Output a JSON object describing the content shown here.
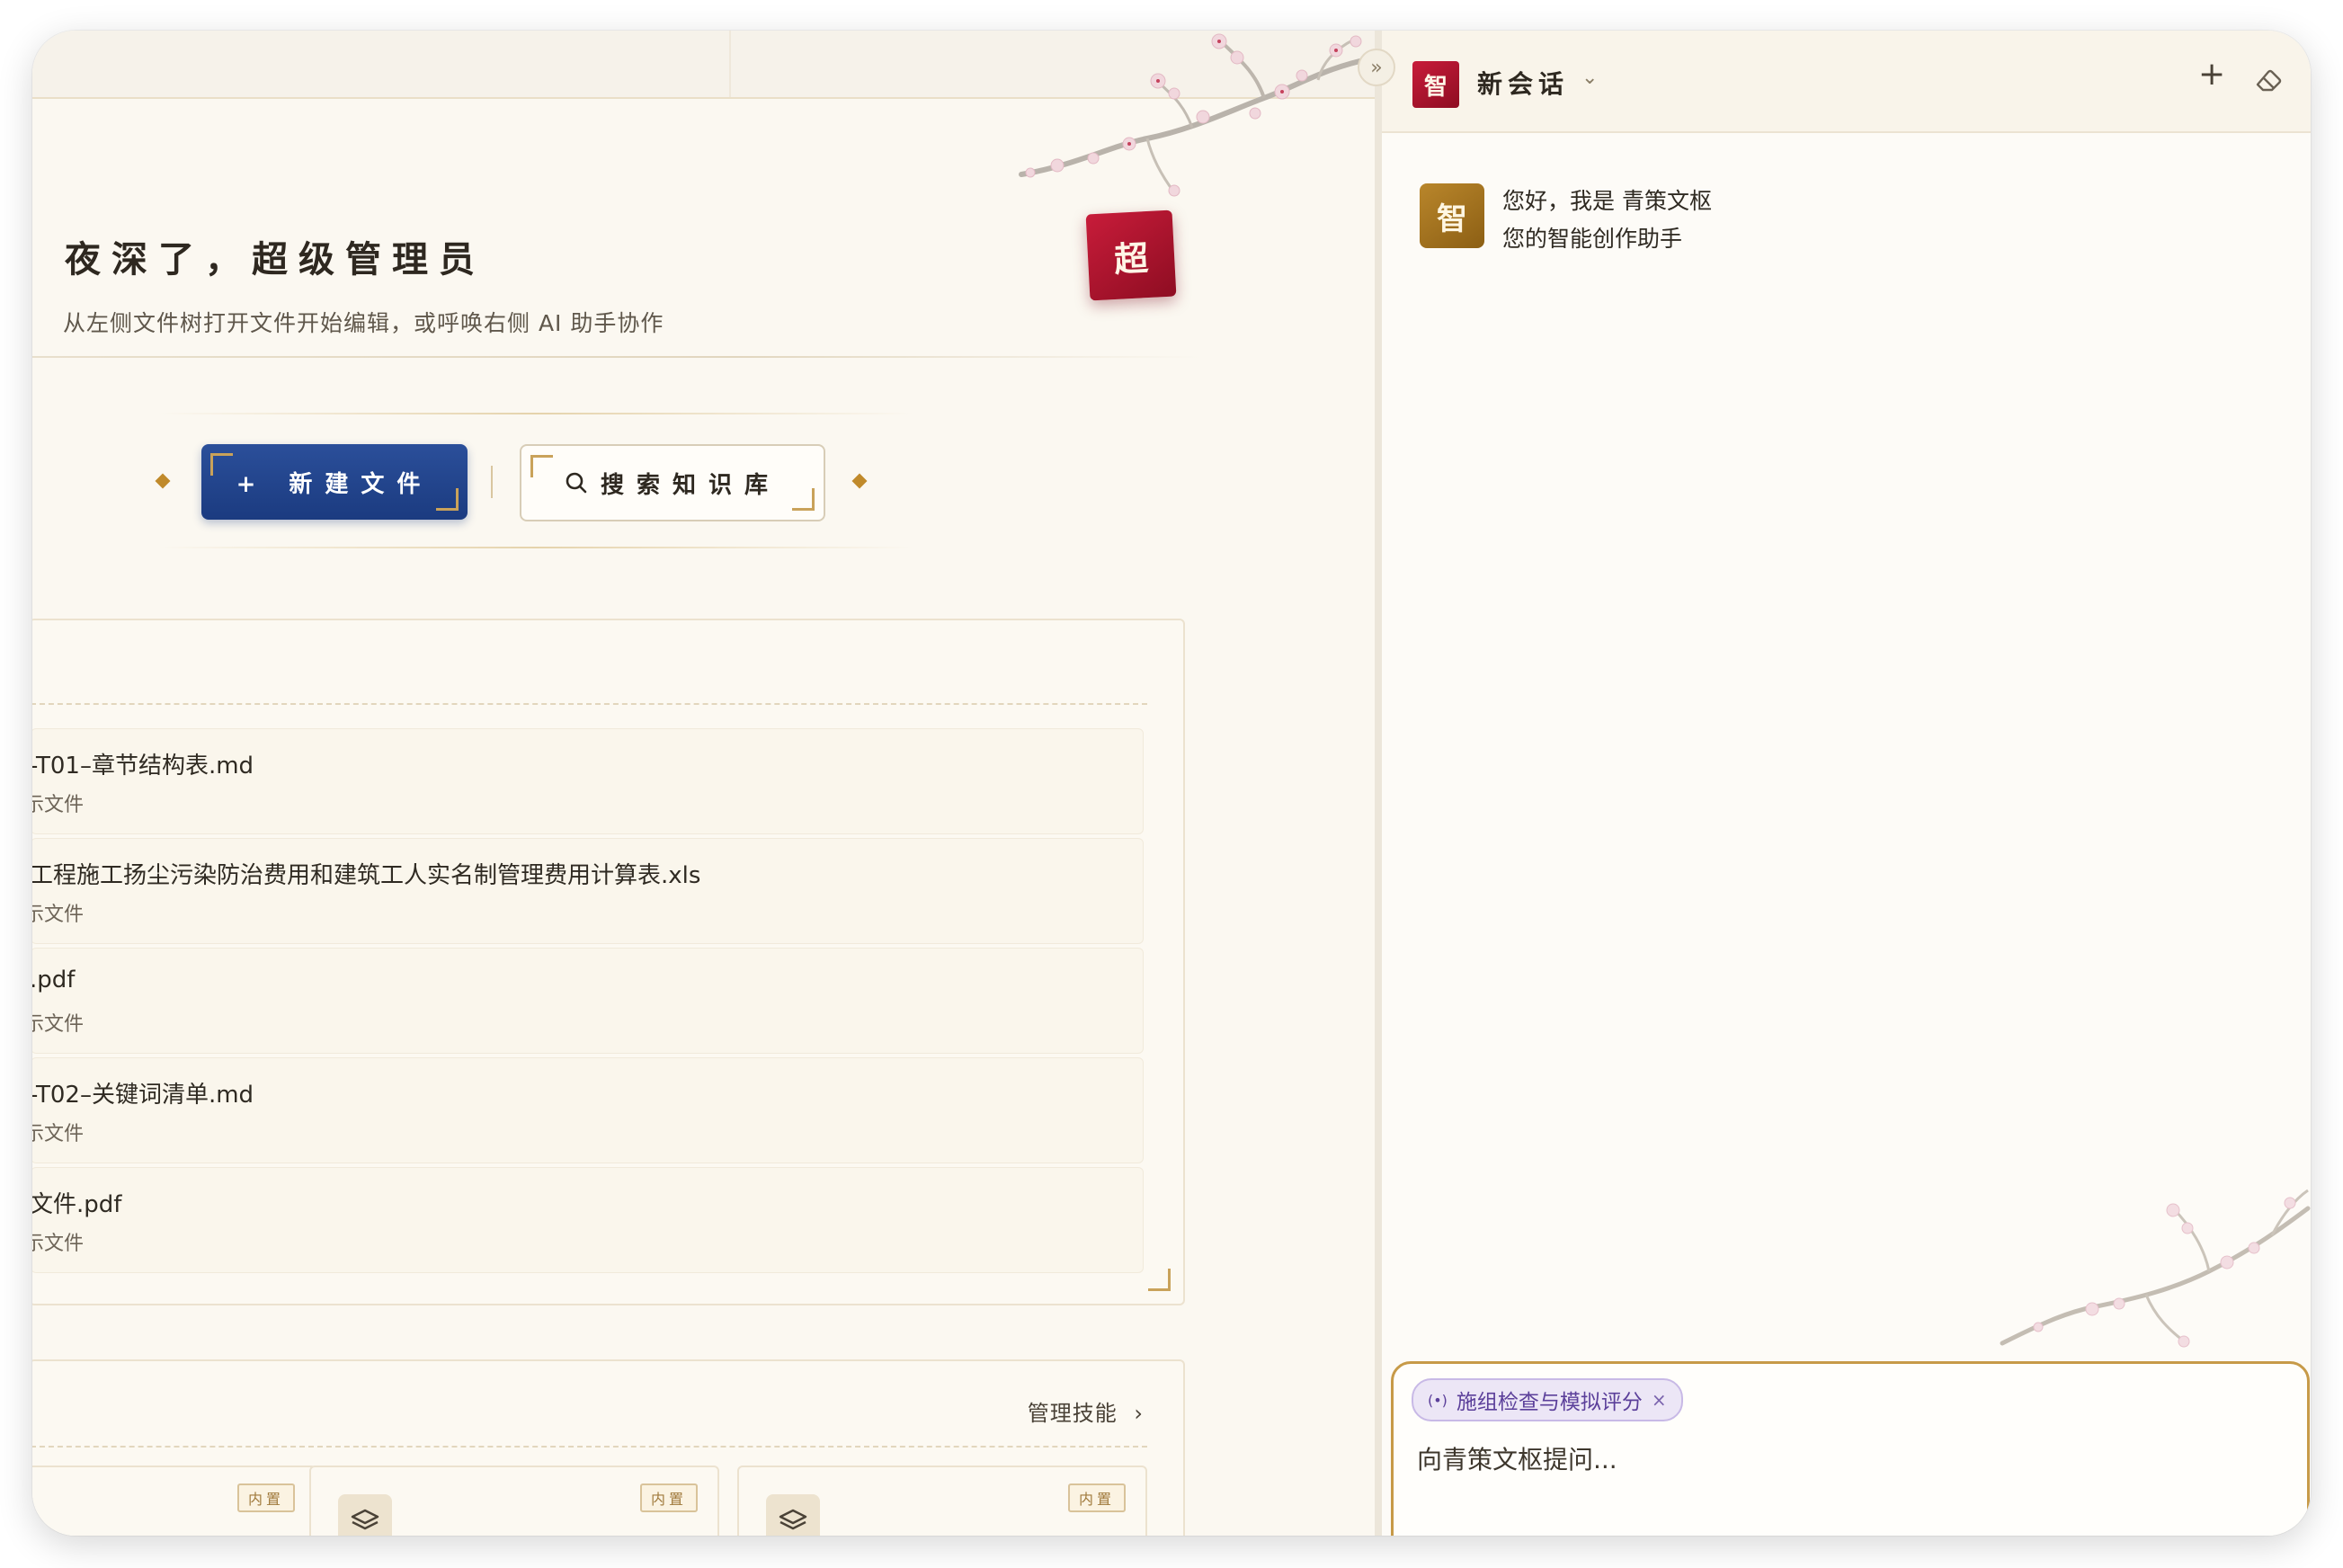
{
  "main": {
    "collapse_glyph": "»",
    "greeting_title": "夜深了，超级管理员",
    "greeting_subtitle": "从左侧文件树打开文件开始编辑，或呼唤右侧 AI 助手协作",
    "user_seal": "超",
    "new_file_label": "+ 新建文件",
    "search_kb_label": "搜索知识库",
    "recent_files": [
      {
        "name": "-T01–章节结构表.md",
        "type": "示文件"
      },
      {
        "name": "工程施工扬尘污染防治费用和建筑工人实名制管理费用计算表.xls",
        "type": "示文件"
      },
      {
        "name": ".pdf",
        "type": "示文件"
      },
      {
        "name": "-T02–关键词清单.md",
        "type": "示文件"
      },
      {
        "name": "文件.pdf",
        "type": "示文件"
      }
    ],
    "skills": {
      "manage_label": "管理技能",
      "manage_chevron": "›",
      "badges": [
        "内置",
        "内置",
        "内置"
      ]
    }
  },
  "assistant": {
    "avatar_glyph": "智",
    "session_title": "新会话",
    "chevron": "⌄",
    "new_chat_glyph": "+",
    "ai_avatar_glyph": "智",
    "greeting_line1": "您好，我是 青策文枢",
    "greeting_line2": "您的智能创作助手",
    "skill_chip_icon": "(•)",
    "skill_chip_label": "施组检查与模拟评分",
    "skill_chip_close": "×",
    "input_placeholder": "向青策文枢提问..."
  },
  "colors": {
    "primary_blue": "#1b3b80",
    "seal_red": "#b0142f",
    "gold": "#c08a2b",
    "chip_purple": "#5b3f9a"
  }
}
